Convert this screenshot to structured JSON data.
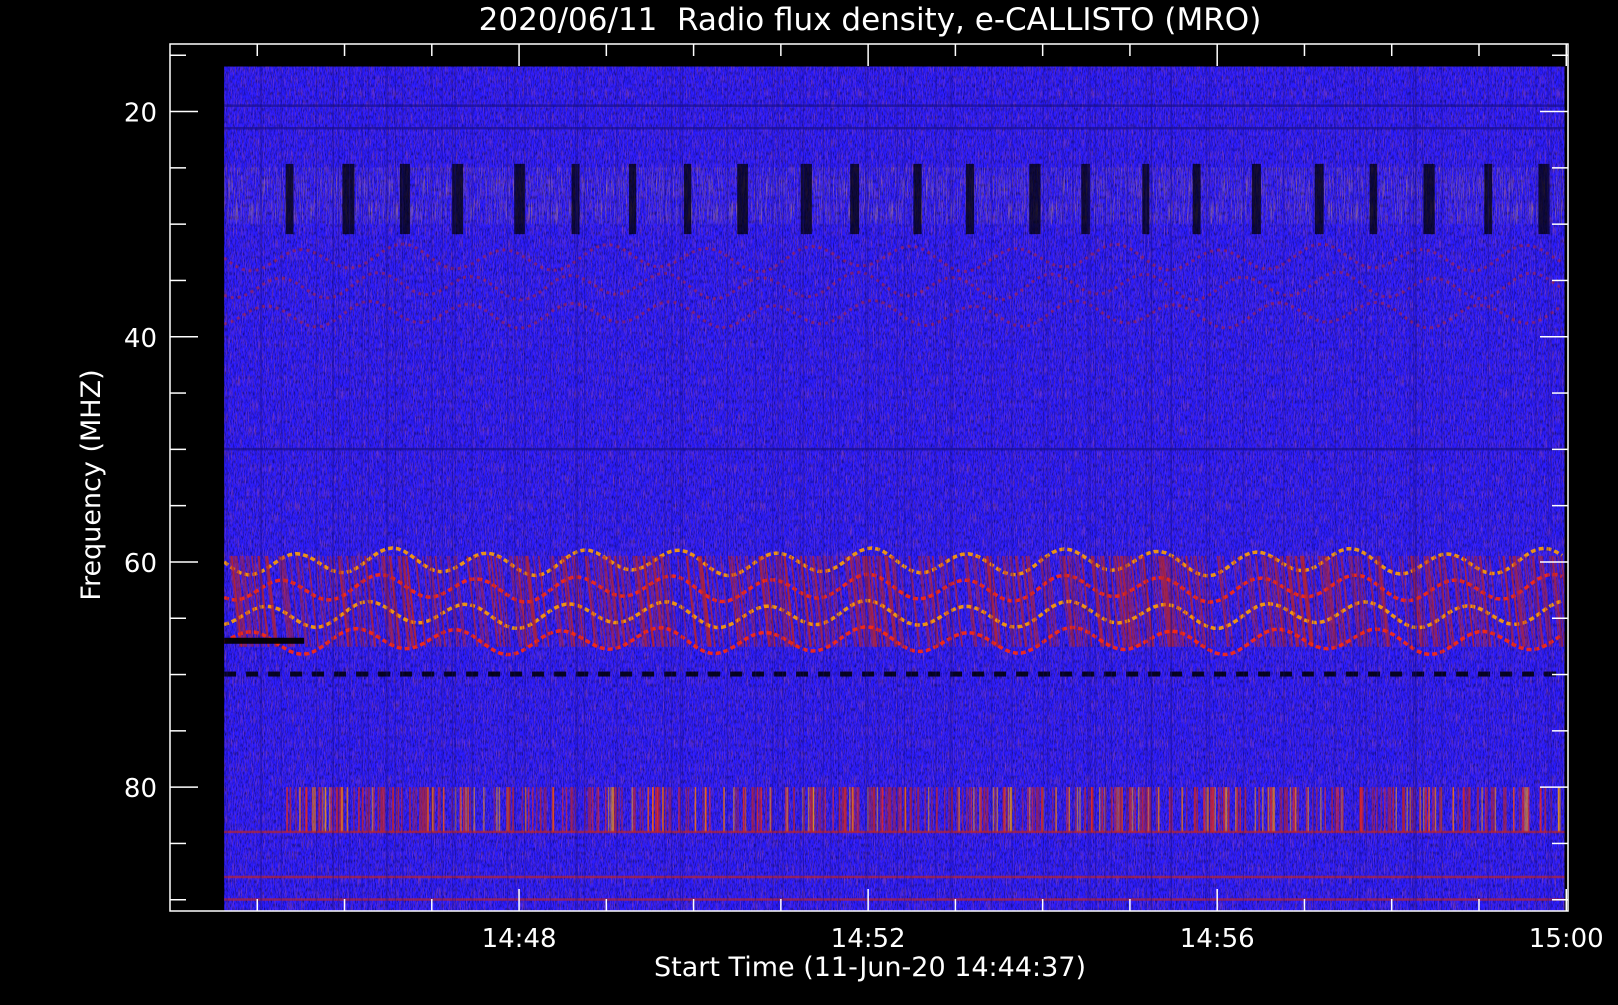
{
  "chart_data": {
    "type": "heatmap",
    "title": "2020/06/11  Radio flux density, e-CALLISTO (MRO)",
    "xlabel": "Start Time (11-Jun-20 14:44:37)",
    "ylabel": "Frequency (MHZ)",
    "x_ticks": [
      "14:48",
      "14:52",
      "14:56",
      "15:00"
    ],
    "y_ticks": [
      "20",
      "40",
      "60",
      "80"
    ],
    "x_tick_minutes": [
      48,
      52,
      56,
      60
    ],
    "y_tick_values": [
      20,
      40,
      60,
      80
    ],
    "xlim_minutes_after_14h": [
      44,
      60.02
    ],
    "data_xlim_minutes_after_14h": [
      44.62,
      59.98
    ],
    "ylim_mhz": [
      14,
      91
    ],
    "data_ylim_mhz": [
      16,
      91
    ],
    "y_inverted": true,
    "colormap": [
      "#000000",
      "#1a0f8c",
      "#2b1cff",
      "#b8232c",
      "#ff2a0a",
      "#ffa000"
    ],
    "background_color": "#2b1cff",
    "features": [
      {
        "description": "bright dense noise band",
        "freq_range_mhz": [
          25,
          30
        ]
      },
      {
        "description": "wavy interference arcs",
        "freq_range_mhz": [
          33,
          38
        ]
      },
      {
        "description": "bright orange wavy emission arcs",
        "freq_range_mhz": [
          60,
          67
        ]
      },
      {
        "description": "dark horizontal gap line",
        "freq_mhz": 70
      },
      {
        "description": "dense vertical striation noise band",
        "freq_range_mhz": [
          80,
          84
        ]
      }
    ]
  }
}
